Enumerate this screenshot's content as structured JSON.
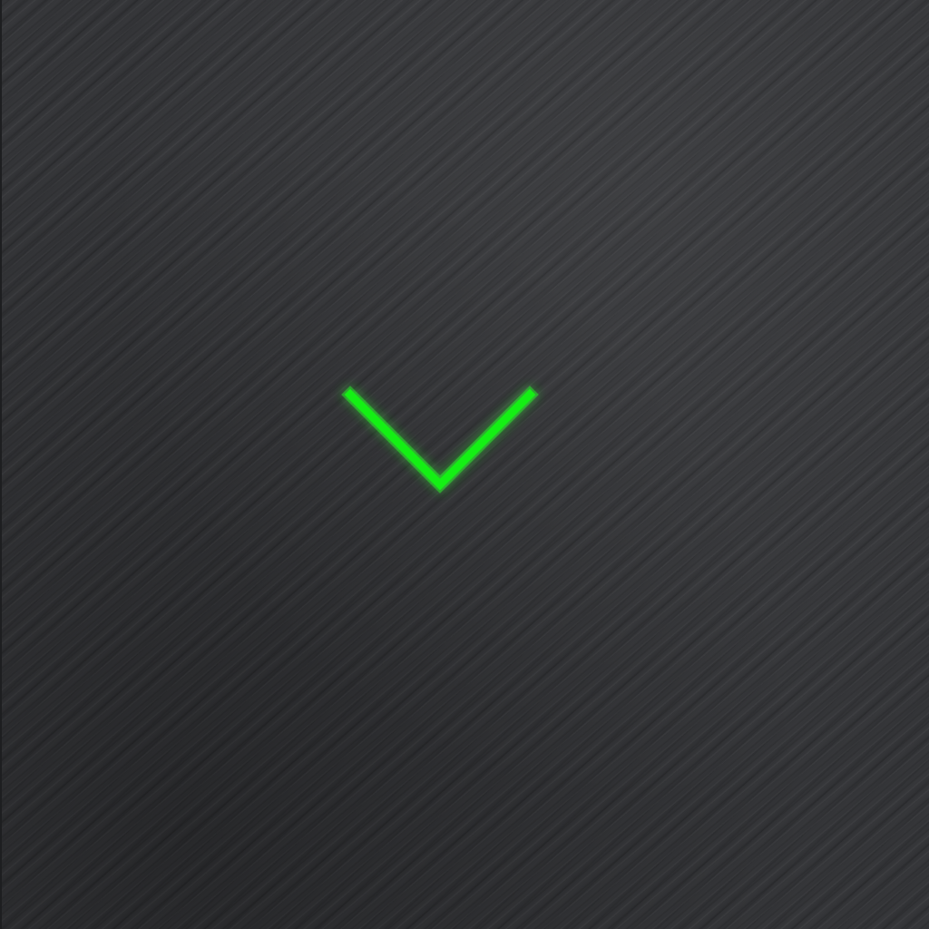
{
  "screen": {
    "background": "brushed-metal",
    "base_color": "#323336"
  },
  "chevron": {
    "icon": "chevron-down-icon",
    "color": "#14f014",
    "glow_color": "#2bff2b"
  }
}
